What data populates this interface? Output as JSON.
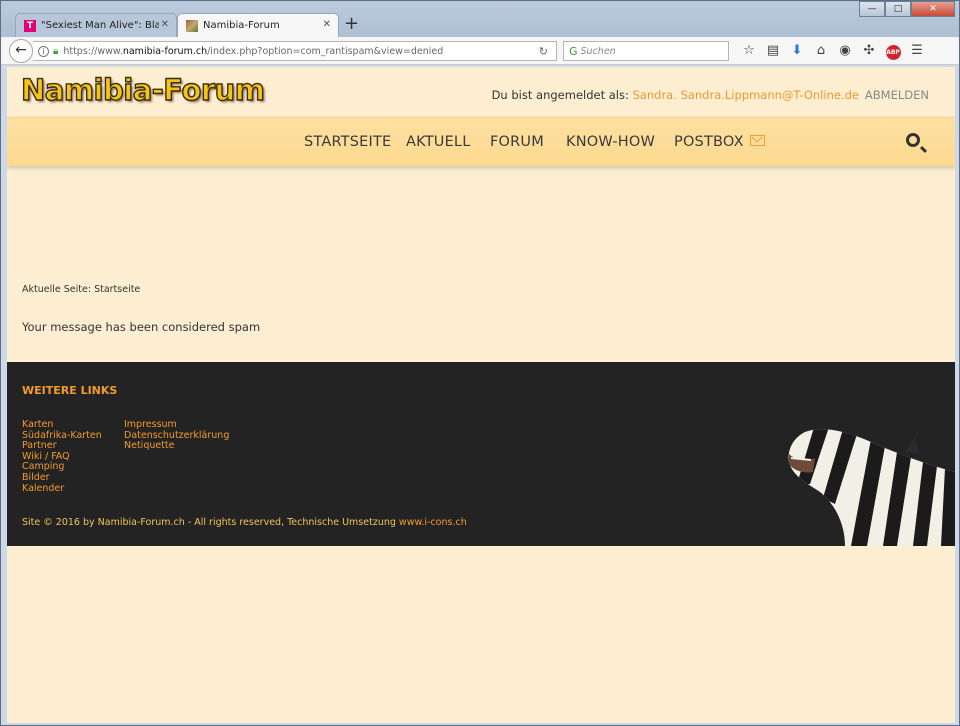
{
  "browser": {
    "tabs": [
      {
        "label": "\"Sexiest Man Alive\": Blake Sh"
      },
      {
        "label": "Namibia-Forum"
      }
    ],
    "url_prefix": "https://www.",
    "url_host": "namibia-forum.ch",
    "url_rest": "/index.php?option=com_rantispam&view=denied",
    "search_placeholder": "Suchen",
    "abp_label": "ABP"
  },
  "header": {
    "logo": "Namibia-Forum",
    "login_prefix": "Du bist angemeldet als:",
    "login_user": "Sandra. Sandra.Lippmann@T-Online.de",
    "logout": "ABMELDEN"
  },
  "nav": {
    "items": [
      "STARTSEITE",
      "AKTUELL",
      "FORUM",
      "KNOW-HOW",
      "POSTBOX"
    ]
  },
  "content": {
    "breadcrumb_label": "Aktuelle Seite:",
    "breadcrumb_page": "Startseite",
    "message": "Your message has been considered spam"
  },
  "footer": {
    "heading": "WEITERE LINKS",
    "col1": [
      "Karten",
      "Südafrika-Karten",
      "Partner",
      "Wiki / FAQ",
      "Camping",
      "Bilder",
      "Kalender"
    ],
    "col2": [
      "Impressum",
      "Datenschutzerklärung",
      "Netiquette"
    ],
    "copyright": "Site © 2016 by Namibia-Forum.ch - All rights reserved, Technische Umsetzung",
    "credit_link": "www.i-cons.ch"
  }
}
